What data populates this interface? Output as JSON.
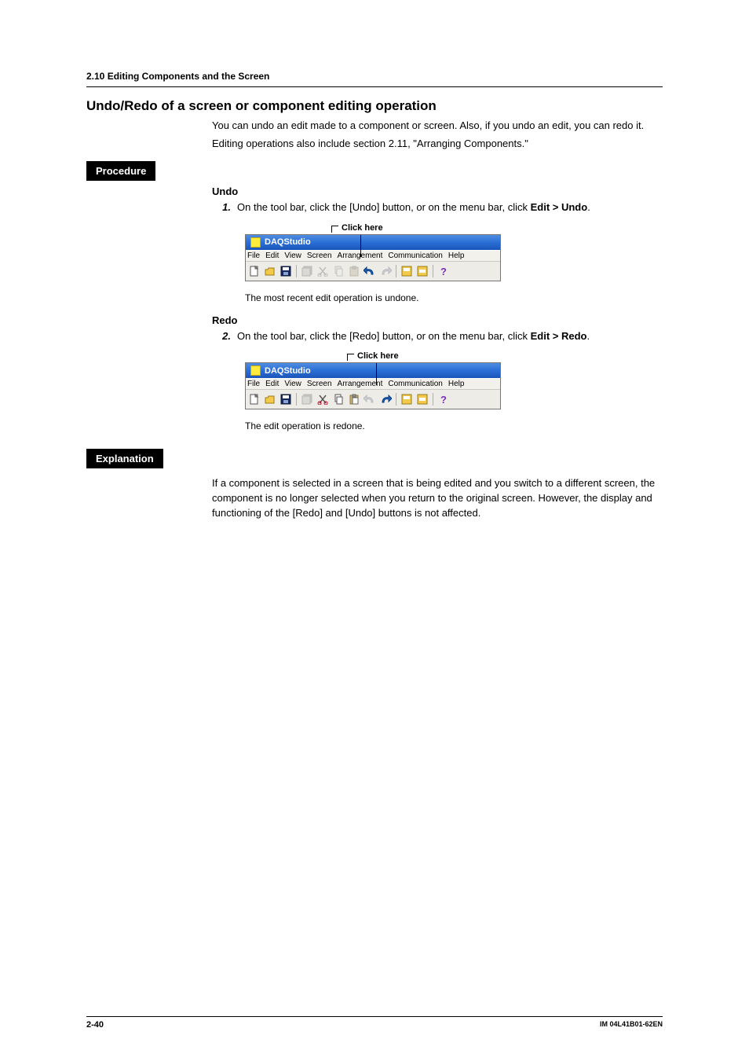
{
  "header": {
    "section": "2.10  Editing Components and the Screen"
  },
  "title": "Undo/Redo of a screen or component editing operation",
  "intro": {
    "p1": "You can undo an edit made to a component or screen. Also, if you undo an edit, you can redo it.",
    "p2": "Editing operations also include section 2.11, \"Arranging Components.\""
  },
  "labels": {
    "procedure": "Procedure",
    "explanation": "Explanation"
  },
  "undo": {
    "heading": "Undo",
    "step_num": "1.",
    "step_pre": "On the tool bar, click the [Undo] button, or on the menu bar, click ",
    "step_bold": "Edit > Undo",
    "step_post": ".",
    "click_here": "Click here",
    "result": "The most recent edit operation is undone."
  },
  "redo": {
    "heading": "Redo",
    "step_num": "2.",
    "step_pre": "On the tool bar, click the [Redo] button, or on the menu bar, click ",
    "step_bold": "Edit > Redo",
    "step_post": ".",
    "click_here": "Click here",
    "result": "The edit operation is redone."
  },
  "screenshot": {
    "app_title": "DAQStudio",
    "menus": [
      "File",
      "Edit",
      "View",
      "Screen",
      "Arrangement",
      "Communication",
      "Help"
    ]
  },
  "explanation_text": "If a component is selected in a screen that is being edited and you switch to a different screen, the component is no longer selected when you return to the original screen. However, the display and functioning of the [Redo] and [Undo] buttons is not affected.",
  "footer": {
    "page": "2-40",
    "doc": "IM 04L41B01-62EN"
  }
}
